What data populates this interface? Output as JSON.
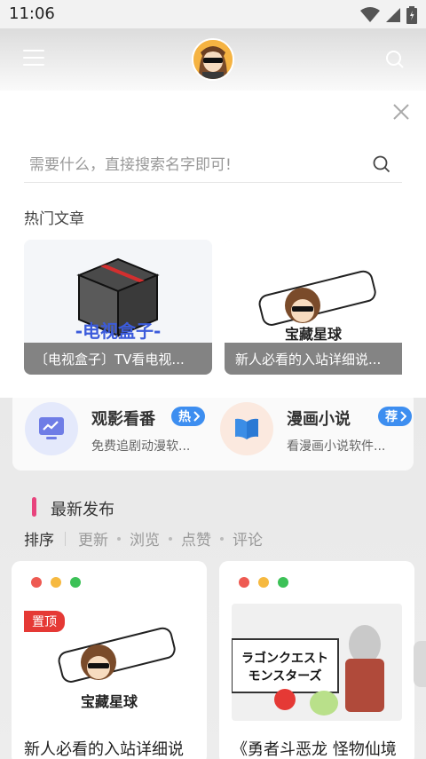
{
  "status_bar": {
    "time": "11:06"
  },
  "search": {
    "placeholder": "需要什么，直接搜索名字即可!"
  },
  "hot_articles": {
    "title": "热门文章",
    "items": [
      {
        "caption": "〔电视盒子〕TV看电视...",
        "overlay_text": "-电视盒子-"
      },
      {
        "caption": "新人必看的入站详细说...",
        "overlay_text": "宝藏星球 需要什么直接搜名字"
      }
    ]
  },
  "features": [
    {
      "title": "观影看番",
      "badge": "热",
      "subtitle": "免费追剧动漫软...",
      "badge_color": "#3d8ef0"
    },
    {
      "title": "漫画小说",
      "badge": "荐",
      "subtitle": "看漫画小说软件...",
      "badge_color": "#3d8ef0"
    }
  ],
  "latest": {
    "title": "最新发布",
    "sort_label": "排序",
    "sort_options": [
      "更新",
      "浏览",
      "点赞",
      "评论"
    ]
  },
  "posts": [
    {
      "title": "新人必看的入站详细说",
      "pin": "置顶"
    },
    {
      "title": "《勇者斗恶龙 怪物仙境"
    }
  ],
  "colors": {
    "accent_pink": "#e8447d",
    "badge_blue": "#3d8ef0",
    "pin_red": "#e53935",
    "dot_red": "#ee5a52",
    "dot_yellow": "#f6b940",
    "dot_green": "#3cc157"
  }
}
